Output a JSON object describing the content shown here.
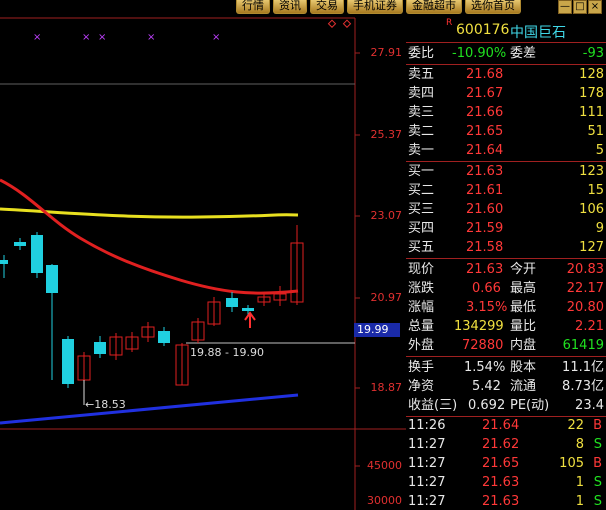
{
  "tabs": [
    "行情",
    "资讯",
    "交易",
    "手机证券",
    "金融超市",
    "选你首页"
  ],
  "window_buttons": [
    "—",
    "□",
    "×"
  ],
  "stock": {
    "code": "600176",
    "name": "中国巨石",
    "flag": "R"
  },
  "chart": {
    "price_labels": [
      "27.91",
      "25.37",
      "23.07",
      "20.97",
      "18.87"
    ],
    "volume_labels": [
      "45000",
      "30000"
    ],
    "current_price_tag": "19.99",
    "range_annotation": "19.88 - 19.90",
    "low_annotation": "←18.53",
    "top_markers": [
      "×",
      "×",
      "×",
      "×",
      "×"
    ],
    "colors": {
      "up": "#e02020",
      "down": "#20d0e0",
      "ma_long": "#e8e020",
      "ma_mid": "#e02020",
      "trend": "#2030e0"
    }
  },
  "order_book": {
    "commission_ratio_label": "委比",
    "commission_ratio_value": "-10.90%",
    "commission_diff_label": "委差",
    "commission_diff_value": "-93",
    "asks": [
      {
        "label": "卖五",
        "price": "21.68",
        "volume": "128"
      },
      {
        "label": "卖四",
        "price": "21.67",
        "volume": "178"
      },
      {
        "label": "卖三",
        "price": "21.66",
        "volume": "111"
      },
      {
        "label": "卖二",
        "price": "21.65",
        "volume": "51"
      },
      {
        "label": "卖一",
        "price": "21.64",
        "volume": "5"
      }
    ],
    "bids": [
      {
        "label": "买一",
        "price": "21.63",
        "volume": "123"
      },
      {
        "label": "买二",
        "price": "21.61",
        "volume": "15"
      },
      {
        "label": "买三",
        "price": "21.60",
        "volume": "106"
      },
      {
        "label": "买四",
        "price": "21.59",
        "volume": "9"
      },
      {
        "label": "买五",
        "price": "21.58",
        "volume": "127"
      }
    ]
  },
  "stats": [
    {
      "l1": "现价",
      "v1": "21.63",
      "l2": "今开",
      "v2": "20.83"
    },
    {
      "l1": "涨跌",
      "v1": "0.66",
      "l2": "最高",
      "v2": "22.17"
    },
    {
      "l1": "涨幅",
      "v1": "3.15%",
      "l2": "最低",
      "v2": "20.80"
    },
    {
      "l1": "总量",
      "v1": "134299",
      "l2": "量比",
      "v2": "2.21"
    },
    {
      "l1": "外盘",
      "v1": "72880",
      "l2": "内盘",
      "v2": "61419"
    }
  ],
  "fundamentals": [
    {
      "l1": "换手",
      "v1": "1.54%",
      "l2": "股本",
      "v2": "11.1亿"
    },
    {
      "l1": "净资",
      "v1": "5.42",
      "l2": "流通",
      "v2": "8.73亿"
    },
    {
      "l1": "收益(三)",
      "v1": "0.692",
      "l2": "PE(动)",
      "v2": "23.4"
    }
  ],
  "ticks": [
    {
      "time": "11:26",
      "price": "21.64",
      "vol": "22",
      "side": "B"
    },
    {
      "time": "11:27",
      "price": "21.62",
      "vol": "8",
      "side": "S"
    },
    {
      "time": "11:27",
      "price": "21.65",
      "vol": "105",
      "side": "B"
    },
    {
      "time": "11:27",
      "price": "21.63",
      "vol": "1",
      "side": "S"
    },
    {
      "time": "11:27",
      "price": "21.63",
      "vol": "1",
      "side": "S"
    }
  ]
}
